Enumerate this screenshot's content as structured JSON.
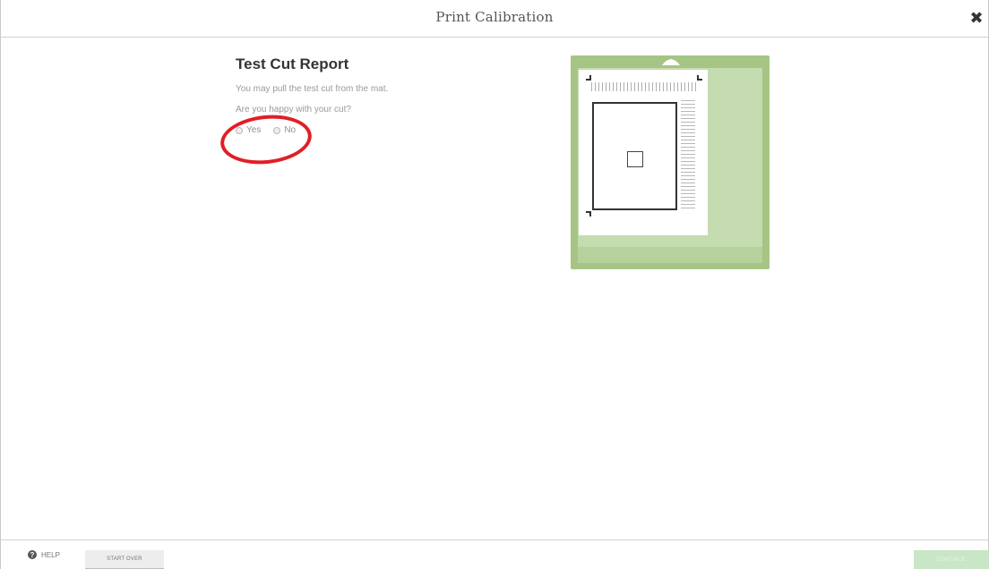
{
  "header": {
    "title": "Print Calibration",
    "close_label": "✖"
  },
  "report": {
    "title": "Test Cut Report",
    "instruction": "You may pull the test cut from the mat.",
    "question": "Are you happy with your cut?",
    "options": [
      {
        "label": "Yes",
        "selected": false
      },
      {
        "label": "No",
        "selected": false
      }
    ]
  },
  "footer": {
    "help_label": "HELP",
    "help_icon": "?",
    "start_over_label": "START OVER",
    "continue_label": "CONTINUE"
  },
  "colors": {
    "mat_green": "#a6c584",
    "highlight_red": "#e01f26",
    "continue_disabled": "#c9e6c6"
  }
}
